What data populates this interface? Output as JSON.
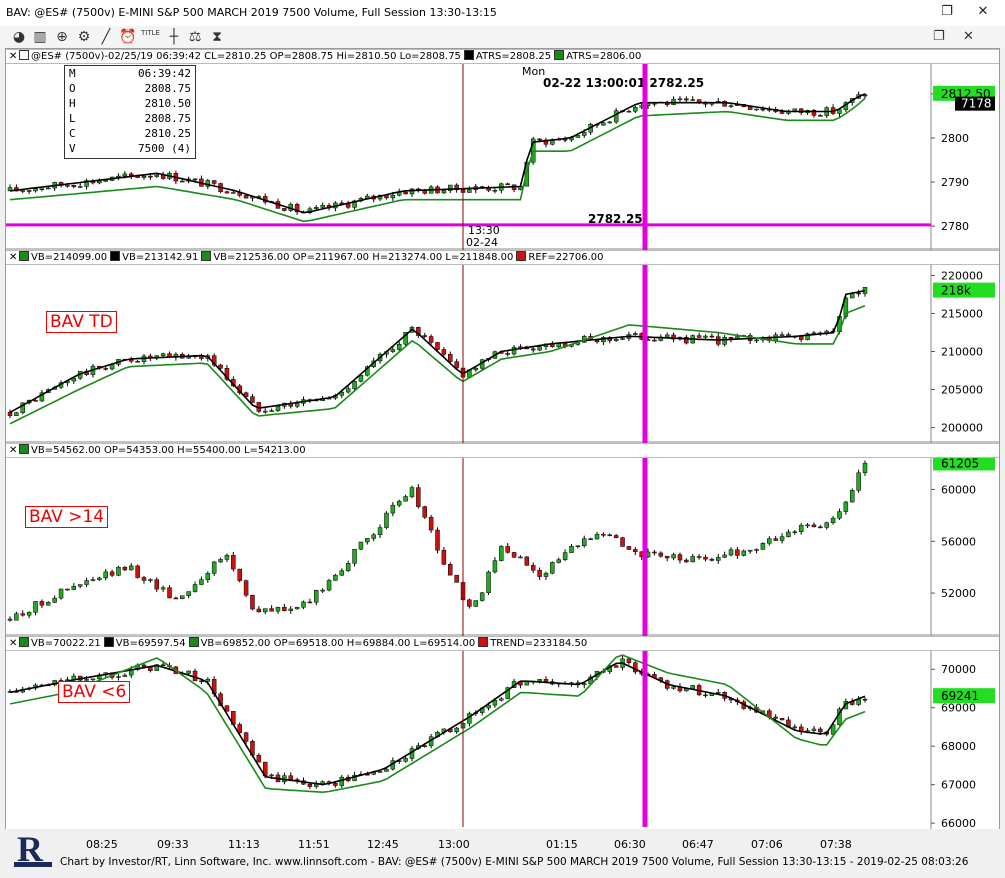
{
  "window": {
    "title": "BAV: @ES# (7500v) E-MINI S&P 500 MARCH 2019 7500 Volume, Full Session 13:30-13:15",
    "restore_glyph": "❐",
    "close_glyph": "✕"
  },
  "toolbar": {
    "icons": [
      "pie-chart-icon",
      "bar-chart-icon",
      "zoom-icon",
      "gear-icon",
      "draw-line-icon",
      "clock-icon",
      "title-icon",
      "crosshair-icon",
      "scale-icon",
      "hourglass-icon"
    ],
    "title_text": "TITLE"
  },
  "colors": {
    "green": "#1a8a1a",
    "black": "#000000",
    "red": "#d01010",
    "magenta": "#e000e0",
    "up_candle": "#22aa22",
    "down_candle": "#cc1111",
    "price_tag": "#22dd22",
    "darkred": "#8b0000"
  },
  "panels": [
    {
      "id": "price",
      "header": [
        "@ES# (7500v)-02/25/19 06:39:42 CL=2810.25 OP=2808.75 Hi=2810.50 Lo=2808.75",
        "ATRS=2808.25",
        "ATRS=2806.00"
      ],
      "header_colors": [
        "#ffffff",
        "#000000",
        "#1a8a1a"
      ],
      "yticks": [
        2780,
        2790,
        2800,
        2810
      ],
      "ymin": 2778,
      "ymax": 2817,
      "last_value": "2812.50",
      "last_volume": "7178",
      "ohlc": [
        [
          "M",
          "06:39:42"
        ],
        [
          "O",
          "2808.75"
        ],
        [
          "H",
          "2810.50"
        ],
        [
          "L",
          "2808.75"
        ],
        [
          "C",
          "2810.25"
        ],
        [
          "V",
          "7500 (4)"
        ]
      ],
      "annotation": "02-22 13:00:01 2782.25",
      "annotation_bottom": "2782.25",
      "day_label": "Mon",
      "session_time": "13:30",
      "session_date": "02-24"
    },
    {
      "id": "bav-td",
      "label": "BAV TD",
      "header": [
        "VB=214099.00",
        "VB=213142.91",
        "VB=212536.00 OP=211967.00 H=213274.00 L=211848.00",
        "REF=22706.00"
      ],
      "header_colors": [
        "#1a8a1a",
        "#000000",
        "#1a8a1a",
        "#d01010"
      ],
      "yticks": [
        200000,
        205000,
        210000,
        215000,
        220000
      ],
      "ytick_labels": [
        "200000",
        "205000",
        "210000",
        "215000",
        "220000"
      ],
      "ymin": 198500,
      "ymax": 221500,
      "last_value": "218k"
    },
    {
      "id": "bav-gt14",
      "label": "BAV >14",
      "header": [
        "VB=54562.00 OP=54353.00 H=55400.00 L=54213.00"
      ],
      "header_colors": [
        "#1a8a1a"
      ],
      "yticks": [
        52000,
        56000,
        60000
      ],
      "ytick_labels": [
        "52000",
        "56000",
        "60000"
      ],
      "ymin": 49000,
      "ymax": 62500,
      "last_value": "61205"
    },
    {
      "id": "bav-lt6",
      "label": "BAV <6",
      "header": [
        "VB=70022.21",
        "VB=69597.54",
        "VB=69852.00 OP=69518.00 H=69884.00 L=69514.00",
        "TREND=233184.50"
      ],
      "header_colors": [
        "#1a8a1a",
        "#000000",
        "#1a8a1a",
        "#d01010"
      ],
      "yticks": [
        66000,
        67000,
        68000,
        69000,
        70000
      ],
      "ytick_labels": [
        "66000",
        "67000",
        "68000",
        "69000",
        "70000"
      ],
      "ymin": 65900,
      "ymax": 70500,
      "last_value": "69241"
    }
  ],
  "xaxis": {
    "labels": [
      "08:25",
      "09:33",
      "11:13",
      "11:51",
      "12:45",
      "13:00",
      "01:15",
      "06:30",
      "06:47",
      "07:06",
      "07:38"
    ]
  },
  "footer": {
    "credit": "Chart by Investor/RT, Linn Software, Inc. www.linnsoft.com - BAV: @ES# (7500v) E-MINI S&P 500 MARCH 2019 7500 Volume, Full Session 13:30-13:15 - 2019-02-25 08:03:26",
    "logo_letter": "R"
  },
  "chart_data": [
    {
      "type": "candlestick",
      "title": "@ES# (7500v)",
      "ylim": [
        2778,
        2817
      ],
      "series": [
        {
          "name": "ATRS=2808.25",
          "anchors": [
            [
              0,
              2788
            ],
            [
              0.15,
              2792
            ],
            [
              0.23,
              2788
            ],
            [
              0.3,
              2783
            ],
            [
              0.4,
              2788
            ],
            [
              0.52,
              2789
            ],
            [
              0.53,
              2799
            ],
            [
              0.57,
              2800
            ],
            [
              0.64,
              2808
            ],
            [
              0.73,
              2808
            ],
            [
              0.79,
              2806
            ],
            [
              0.84,
              2806
            ],
            [
              0.86,
              2809
            ],
            [
              0.87,
              2810
            ]
          ]
        },
        {
          "name": "ATRS=2806.00",
          "anchors": [
            [
              0,
              2786
            ],
            [
              0.15,
              2789
            ],
            [
              0.23,
              2786
            ],
            [
              0.3,
              2781
            ],
            [
              0.4,
              2786
            ],
            [
              0.52,
              2786
            ],
            [
              0.53,
              2797
            ],
            [
              0.57,
              2797
            ],
            [
              0.64,
              2805
            ],
            [
              0.73,
              2806
            ],
            [
              0.79,
              2804
            ],
            [
              0.84,
              2804
            ],
            [
              0.86,
              2807
            ],
            [
              0.87,
              2809
            ]
          ]
        }
      ]
    },
    {
      "type": "candlestick",
      "title": "BAV TD",
      "ylim": [
        198500,
        221500
      ],
      "series": [
        {
          "name": "VB=213142.91",
          "anchors": [
            [
              0,
              202000
            ],
            [
              0.07,
              207000
            ],
            [
              0.12,
              209000
            ],
            [
              0.2,
              209500
            ],
            [
              0.25,
              202500
            ],
            [
              0.33,
              204000
            ],
            [
              0.41,
              213000
            ],
            [
              0.46,
              207000
            ],
            [
              0.5,
              210000
            ],
            [
              0.55,
              211000
            ],
            [
              0.63,
              212000
            ],
            [
              0.72,
              211500
            ],
            [
              0.8,
              212000
            ],
            [
              0.84,
              212500
            ],
            [
              0.85,
              217500
            ],
            [
              0.87,
              218000
            ]
          ]
        },
        {
          "name": "VB=212536.00",
          "anchors": [
            [
              0,
              200500
            ],
            [
              0.07,
              205000
            ],
            [
              0.12,
              208000
            ],
            [
              0.2,
              208500
            ],
            [
              0.25,
              201500
            ],
            [
              0.33,
              202500
            ],
            [
              0.41,
              211500
            ],
            [
              0.46,
              206000
            ],
            [
              0.5,
              209000
            ],
            [
              0.55,
              210000
            ],
            [
              0.63,
              213500
            ],
            [
              0.72,
              212500
            ],
            [
              0.8,
              211000
            ],
            [
              0.84,
              211000
            ],
            [
              0.85,
              215000
            ],
            [
              0.87,
              216000
            ]
          ]
        }
      ]
    },
    {
      "type": "candlestick",
      "title": "BAV >14",
      "ylim": [
        49000,
        62500
      ],
      "series": [
        {
          "name": "VB=54562.00",
          "anchors": [
            [
              0,
              50000
            ],
            [
              0.05,
              52000
            ],
            [
              0.12,
              54000
            ],
            [
              0.17,
              51500
            ],
            [
              0.22,
              55000
            ],
            [
              0.25,
              50500
            ],
            [
              0.3,
              51000
            ],
            [
              0.35,
              55000
            ],
            [
              0.39,
              58500
            ],
            [
              0.41,
              60000
            ],
            [
              0.44,
              54500
            ],
            [
              0.47,
              50500
            ],
            [
              0.5,
              55500
            ],
            [
              0.54,
              53500
            ],
            [
              0.6,
              57000
            ],
            [
              0.64,
              55000
            ],
            [
              0.7,
              54500
            ],
            [
              0.76,
              55500
            ],
            [
              0.8,
              57000
            ],
            [
              0.84,
              57500
            ],
            [
              0.87,
              62000
            ]
          ]
        }
      ]
    },
    {
      "type": "candlestick",
      "title": "BAV <6",
      "ylim": [
        65900,
        70500
      ],
      "series": [
        {
          "name": "VB=69597.54",
          "anchors": [
            [
              0,
              69400
            ],
            [
              0.06,
              69700
            ],
            [
              0.15,
              70100
            ],
            [
              0.2,
              69700
            ],
            [
              0.26,
              67200
            ],
            [
              0.32,
              67000
            ],
            [
              0.38,
              67400
            ],
            [
              0.47,
              68800
            ],
            [
              0.52,
              69700
            ],
            [
              0.58,
              69600
            ],
            [
              0.62,
              70200
            ],
            [
              0.67,
              69600
            ],
            [
              0.73,
              69300
            ],
            [
              0.8,
              68400
            ],
            [
              0.83,
              68300
            ],
            [
              0.85,
              69100
            ],
            [
              0.87,
              69300
            ]
          ]
        },
        {
          "name": "VB=69852.00",
          "anchors": [
            [
              0,
              69100
            ],
            [
              0.06,
              69400
            ],
            [
              0.15,
              70300
            ],
            [
              0.2,
              69400
            ],
            [
              0.26,
              66900
            ],
            [
              0.32,
              66800
            ],
            [
              0.38,
              67100
            ],
            [
              0.47,
              68500
            ],
            [
              0.52,
              69400
            ],
            [
              0.58,
              69300
            ],
            [
              0.62,
              70400
            ],
            [
              0.67,
              69900
            ],
            [
              0.73,
              69600
            ],
            [
              0.8,
              68200
            ],
            [
              0.83,
              68000
            ],
            [
              0.85,
              68700
            ],
            [
              0.87,
              68900
            ]
          ]
        }
      ]
    }
  ]
}
